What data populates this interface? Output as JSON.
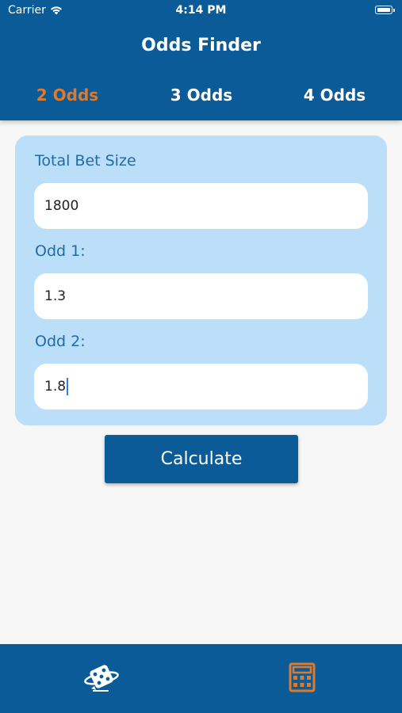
{
  "status": {
    "carrier": "Carrier",
    "time": "4:14 PM"
  },
  "header": {
    "title": "Odds Finder"
  },
  "tabs": [
    {
      "label": "2 Odds",
      "active": true
    },
    {
      "label": "3 Odds",
      "active": false
    },
    {
      "label": "4 Odds",
      "active": false
    }
  ],
  "form": {
    "total_label": "Total Bet Size",
    "total_value": "1800",
    "odd1_label": "Odd 1:",
    "odd1_value": "1.3",
    "odd2_label": "Odd 2:",
    "odd2_value": "1.8"
  },
  "actions": {
    "calculate_label": "Calculate"
  },
  "bottom_nav": {
    "items": [
      {
        "icon": "dice-icon",
        "active": false
      },
      {
        "icon": "calculator-icon",
        "active": true
      }
    ]
  },
  "colors": {
    "primary": "#0a5b97",
    "accent": "#e07a2b",
    "card": "#bcdff9",
    "label": "#1f6aa8"
  }
}
